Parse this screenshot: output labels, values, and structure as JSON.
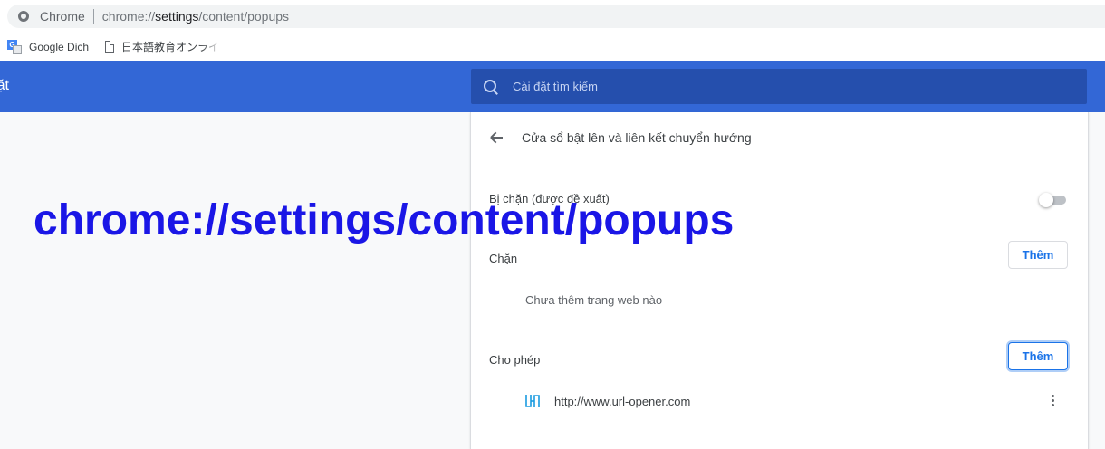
{
  "browser": {
    "chip_label": "Chrome",
    "url": {
      "scheme": "chrome://",
      "host": "settings",
      "path": "/content/popups"
    }
  },
  "bookmarks": [
    {
      "label": "Google Dich",
      "icon": "google-translate-icon"
    },
    {
      "label": "日本語教育オンライン",
      "icon": "page-icon"
    }
  ],
  "header": {
    "title_fragment": "ặt",
    "search_placeholder": "Cài đặt tìm kiếm"
  },
  "popups_page": {
    "title": "Cửa sổ bật lên và liên kết chuyển hướng",
    "blocked_toggle_label": "Bị chặn (được đề xuất)",
    "blocked_toggle_on": false,
    "block_section": {
      "label": "Chặn",
      "add_label": "Thêm",
      "empty_text": "Chưa thêm trang web nào"
    },
    "allow_section": {
      "label": "Cho phép",
      "add_label": "Thêm",
      "sites": [
        {
          "url": "http://www.url-opener.com",
          "icon": "url-opener-icon"
        }
      ]
    }
  },
  "overlay": {
    "text": "chrome://settings/content/popups",
    "color": "#1a16e6"
  },
  "colors": {
    "header_bg": "#3367d6",
    "search_bg": "#254fad",
    "accent": "#1a73e8"
  }
}
